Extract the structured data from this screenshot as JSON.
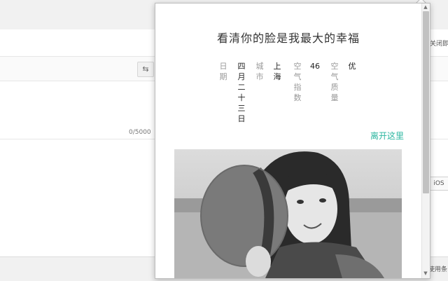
{
  "background": {
    "char_count": "0/5000",
    "close_label": "关闭即",
    "ios_label": "iOS",
    "use_label": "使用条",
    "swap_icon": "⇆"
  },
  "popup": {
    "headline": "看清你的脸是我最大的幸福",
    "date_label": [
      "日",
      "期"
    ],
    "date_value": [
      "四",
      "月",
      "二",
      "十",
      "三",
      "日"
    ],
    "city_label": [
      "城",
      "市"
    ],
    "city_value": [
      "上",
      "海"
    ],
    "aqi_label": [
      "空",
      "气",
      "指",
      "数"
    ],
    "aqi_value": "46",
    "quality_label": [
      "空",
      "气",
      "质",
      "量"
    ],
    "quality_value": [
      "优"
    ],
    "leave_link": "离开这里",
    "photo_icon": "portrait-photo",
    "link_color": "#2bb6a0"
  },
  "scrollbar": {
    "up_arrow": "▲",
    "down_arrow": "▼"
  }
}
